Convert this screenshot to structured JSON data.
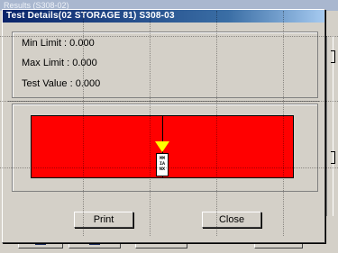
{
  "background_window": {
    "title": "Results (S308-02)"
  },
  "dialog": {
    "title": "Test Details(02 STORAGE 81) S308-03",
    "min_limit": "Min Limit : 0.000",
    "max_limit": "Max Limit : 0.000",
    "test_value": "Test Value : 0.000",
    "gauge": {
      "bar_color": "#ff0000",
      "pointer_color": "#ffff00",
      "tag_text": [
        "MM",
        "IA",
        "NX"
      ]
    },
    "buttons": {
      "print": "Print",
      "close": "Close"
    }
  }
}
